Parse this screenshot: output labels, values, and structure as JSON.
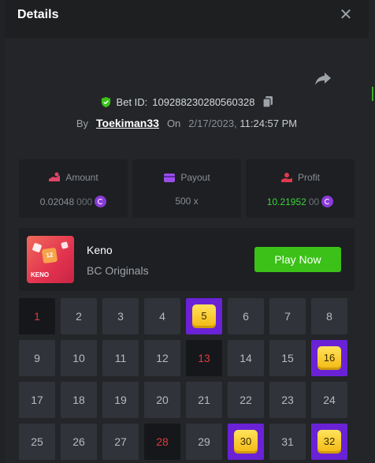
{
  "modal": {
    "title": "Details",
    "close_icon": "close-icon",
    "share_icon": "share-icon"
  },
  "bet": {
    "id_label": "Bet ID:",
    "id_value": "109288230280560328",
    "by_label": "By",
    "user": "Toekiman33",
    "on_label": "On",
    "date": "2/17/2023,",
    "time": "11:24:57 PM"
  },
  "stats": {
    "amount": {
      "label": "Amount",
      "value_main": "0.02048",
      "value_dim": "000",
      "icon": "amount-icon"
    },
    "payout": {
      "label": "Payout",
      "value_main": "500 x",
      "icon": "wallet-icon"
    },
    "profit": {
      "label": "Profit",
      "value_main": "10.21952",
      "value_dim": "00",
      "icon": "profit-hand-icon"
    }
  },
  "game": {
    "thumb_number": "12",
    "thumb_name": "KENO",
    "title": "Keno",
    "subtitle": "BC Originals",
    "play_label": "Play Now"
  },
  "grid": {
    "numbers": [
      "1",
      "2",
      "3",
      "4",
      "5",
      "6",
      "7",
      "8",
      "9",
      "10",
      "11",
      "12",
      "13",
      "14",
      "15",
      "16",
      "17",
      "18",
      "19",
      "20",
      "21",
      "22",
      "23",
      "24",
      "25",
      "26",
      "27",
      "28",
      "29",
      "30",
      "31",
      "32"
    ],
    "misses": [
      "1",
      "13",
      "28"
    ],
    "hits": [
      "5",
      "16",
      "30",
      "32"
    ]
  },
  "colors": {
    "accent_green": "#3bc117",
    "hit_purple": "#6a22d6",
    "gem_yellow": "#f3b812",
    "miss_red": "#e0393d"
  }
}
